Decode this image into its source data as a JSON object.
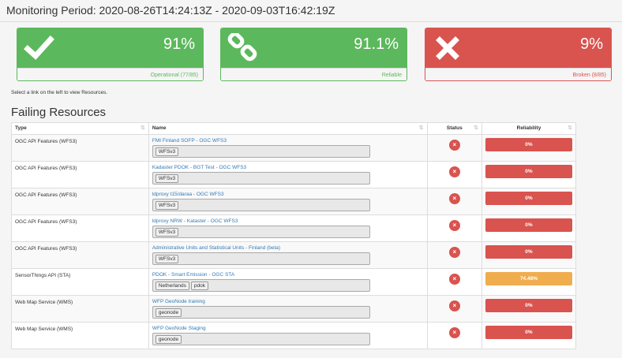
{
  "header": {
    "title": "Monitoring Period: 2020-08-26T14:24:13Z - 2020-09-03T16:42:19Z"
  },
  "panels": [
    {
      "pct": "91%",
      "label": "Operational (77/85)",
      "icon": "check-icon",
      "color": "#5cb85c"
    },
    {
      "pct": "91.1%",
      "label": "Reliable",
      "icon": "link-icon",
      "color": "#5cb85c"
    },
    {
      "pct": "9%",
      "label": "Broken (8/85)",
      "icon": "times-icon",
      "color": "#d9534f"
    }
  ],
  "hint": "Select a link on the left to view Resources.",
  "section_title": "Failing Resources",
  "table": {
    "headers": {
      "type": "Type",
      "name": "Name",
      "status": "Status",
      "reliability": "Reliability"
    },
    "rows": [
      {
        "type": "OGC API Features (WFS3)",
        "name": "FMI Finland SOFP - OGC WFS3",
        "tags": [
          "WFSv3"
        ],
        "status": "×",
        "reliability": "0%"
      },
      {
        "type": "OGC API Features (WFS3)",
        "name": "Kadaster PDOK - BGT Test - OGC WFS3",
        "tags": [
          "WFSv3"
        ],
        "status": "×",
        "reliability": "0%"
      },
      {
        "type": "OGC API Features (WFS3)",
        "name": "ldproxy t15/daraa - OGC WFS3",
        "tags": [
          "WFSv3"
        ],
        "status": "×",
        "reliability": "0%"
      },
      {
        "type": "OGC API Features (WFS3)",
        "name": "ldproxy NRW - Kataster - OGC WFS3",
        "tags": [
          "WFSv3"
        ],
        "status": "×",
        "reliability": "0%"
      },
      {
        "type": "OGC API Features (WFS3)",
        "name": "Administrative Units and Statistical Units - Finland (beta)",
        "tags": [
          "WFSv3"
        ],
        "status": "×",
        "reliability": "0%"
      },
      {
        "type": "SensorThings API (STA)",
        "name": "PDOK - Smart Emission - OGC STA",
        "tags": [
          "Netherlands",
          "pdok"
        ],
        "status": "×",
        "reliability": "74.48%"
      },
      {
        "type": "Web Map Service (WMS)",
        "name": "WFP GeoNode training",
        "tags": [
          "geonode"
        ],
        "status": "×",
        "reliability": "0%"
      },
      {
        "type": "Web Map Service (WMS)",
        "name": "WFP GeoNode Staging",
        "tags": [
          "geonode"
        ],
        "status": "×",
        "reliability": "0%"
      }
    ]
  }
}
